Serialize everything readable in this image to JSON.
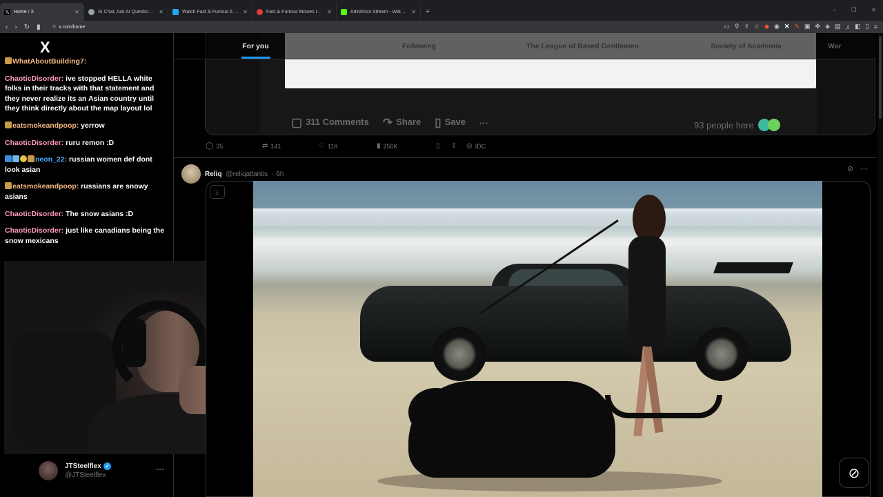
{
  "browser": {
    "tabs": [
      {
        "label": "Home / X",
        "active": true,
        "favicon_color": "#000000"
      },
      {
        "label": "AI Chat, Ask AI Questions for Expert",
        "active": false,
        "favicon_color": "#9aa0a6"
      },
      {
        "label": "Watch Fast & Furious 6 2013 full HD",
        "active": false,
        "favicon_color": "#22a7f0"
      },
      {
        "label": "Fast & Furious Movies In Order: How",
        "active": false,
        "favicon_color": "#e53935"
      },
      {
        "label": "AdinRoss Stream - Watch Live on Ki",
        "active": false,
        "favicon_color": "#53fc18"
      }
    ],
    "new_tab": "+",
    "url": "x.com/home",
    "window_controls": [
      "–",
      "❐",
      "✕"
    ]
  },
  "x": {
    "logo": "X",
    "feed_tabs": [
      "For you",
      "Following",
      "The League of Based Gentlemen",
      "Society of Academia",
      "War"
    ],
    "active_tab": 0
  },
  "chat": [
    {
      "user": "WhatAboutBuilding7:",
      "text": "",
      "user_color": "#f2b880",
      "badges": 1
    },
    {
      "user": "ChaoticDisorder:",
      "text": " ive stopped HELLA white folks in their tracks with that statement and they never realize its an Asian country until they think directly about the map layout lol",
      "user_color": "#ff9bbd",
      "badges": 0
    },
    {
      "user": "eatsmokeandpoop:",
      "text": " yerrow",
      "user_color": "#f2b880",
      "badges": 1
    },
    {
      "user": "ChaoticDisorder:",
      "text": " ruru remon :D",
      "user_color": "#ff9bbd",
      "badges": 0
    },
    {
      "user": "neon_22:",
      "text": " russian women def dont look asian",
      "user_color": "#4aa7ff",
      "badges": 3
    },
    {
      "user": "eatsmokeandpoop:",
      "text": " russians are snowy asians",
      "user_color": "#f2b880",
      "badges": 1
    },
    {
      "user": "ChaoticDisorder:",
      "text": " The snow asians :D",
      "user_color": "#ff9bbd",
      "badges": 0
    },
    {
      "user": "ChaoticDisorder:",
      "text": " just like canadians being the snow mexicans",
      "user_color": "#ff9bbd",
      "badges": 0
    }
  ],
  "profile": {
    "name": "JTSteelflex",
    "handle": "@JTSteelflex",
    "more": "···"
  },
  "card": {
    "comments": "311 Comments",
    "share": "Share",
    "save": "Save",
    "more": "···",
    "people_here": "93 people here"
  },
  "stats": {
    "replies": "35",
    "reposts": "141",
    "likes": "11K",
    "views": "256K",
    "extra": "IDC"
  },
  "post2": {
    "name": "Reliq",
    "handle": "@reliqatlantis",
    "time": "· 6h",
    "more": "⋯"
  }
}
